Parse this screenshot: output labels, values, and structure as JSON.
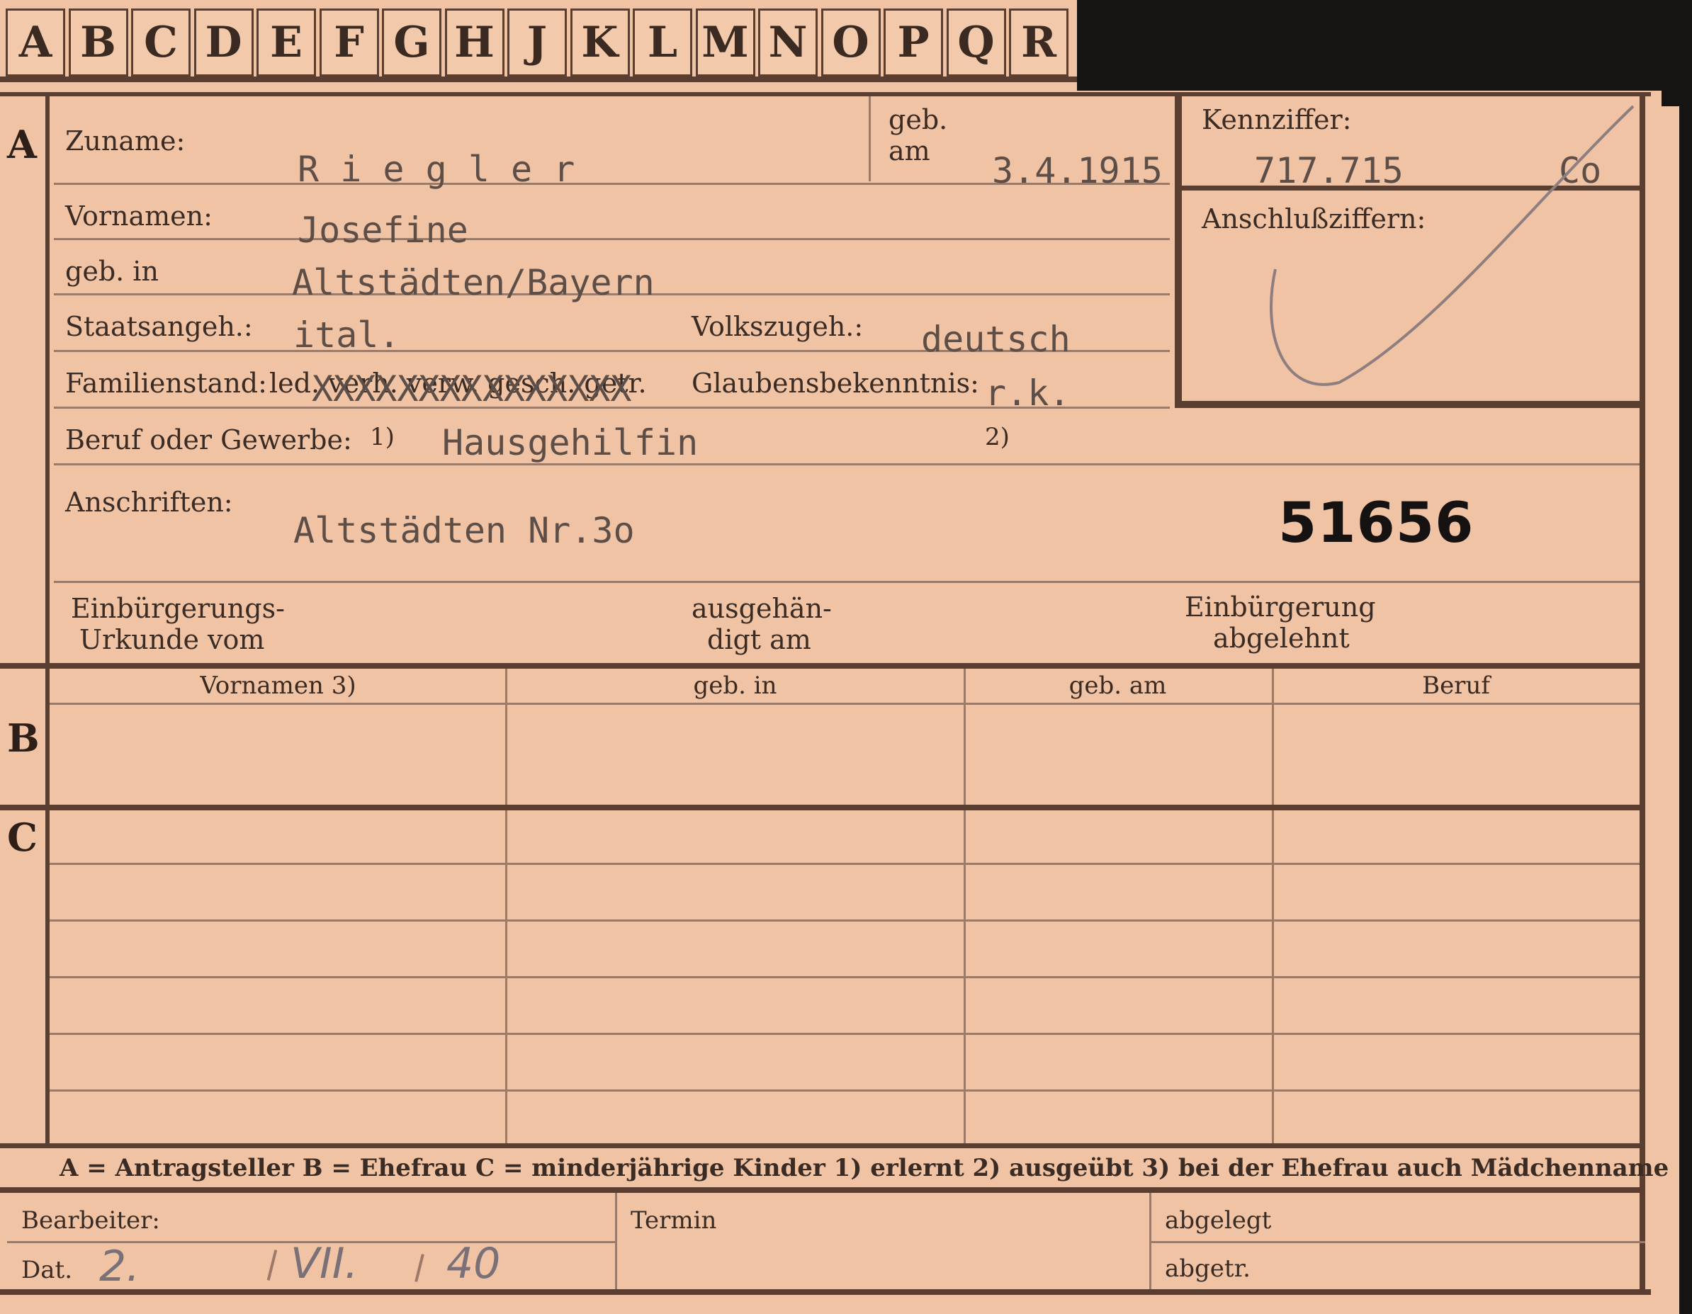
{
  "tabs": [
    "A",
    "B",
    "C",
    "D",
    "E",
    "F",
    "G",
    "H",
    "J",
    "K",
    "L",
    "M",
    "N",
    "O",
    "P",
    "Q",
    "R"
  ],
  "sections": {
    "a": "A",
    "b": "B",
    "c": "C"
  },
  "fields": {
    "zuname_label": "Zuname:",
    "zuname": "R i e g l e r",
    "geb_label": "geb.",
    "am_label": "am",
    "geb_am": "3.4.1915",
    "kennziffer_label": "Kennziffer:",
    "kennziffer": "717.715",
    "kennziffer_suffix": "Co",
    "anschluss_label": "Anschlußziffern:",
    "vornamen_label": "Vornamen:",
    "vornamen": "Josefine",
    "geb_in_label": "geb. in",
    "geb_in": "Altstädten/Bayern",
    "staatsangeh_label": "Staatsangeh.:",
    "staatsangeh": "ital.",
    "volkszugeh_label": "Volkszugeh.:",
    "volkszugeh": "deutsch",
    "familienstand_label": "Familienstand:",
    "familienstand_options": "led. verh. verw. gesch. getr.",
    "glauben_label": "Glaubensbekenntnis:",
    "glauben": "r.k.",
    "beruf_label": "Beruf oder Gewerbe:",
    "fn1": "1)",
    "fn2": "2)",
    "beruf": "Hausgehilfin",
    "anschriften_label": "Anschriften:",
    "anschrift": "Altstädten Nr.3o",
    "stamp_number": "51656",
    "einb_label_1": "Einbürgerungs-",
    "einb_label_2": "Urkunde vom",
    "ausgeh_label_1": "ausgehän-",
    "ausgeh_label_2": "digt am",
    "abgelehnt_label_1": "Einbürgerung",
    "abgelehnt_label_2": "abgelehnt"
  },
  "table": {
    "headers": [
      "Vornamen 3)",
      "geb. in",
      "geb. am",
      "Beruf"
    ]
  },
  "legend": "A = Antragsteller   B = Ehefrau   C = minderjährige Kinder   1) erlernt   2) ausgeübt   3) bei der Ehefrau auch Mädchenname",
  "footer": {
    "bearbeiter_label": "Bearbeiter:",
    "dat_label": "Dat.",
    "date_day": "2.",
    "date_month": "VII.",
    "date_year": "40",
    "termin_label": "Termin",
    "abgelegt_label": "abgelegt",
    "abgetr_label": "abgetr."
  }
}
